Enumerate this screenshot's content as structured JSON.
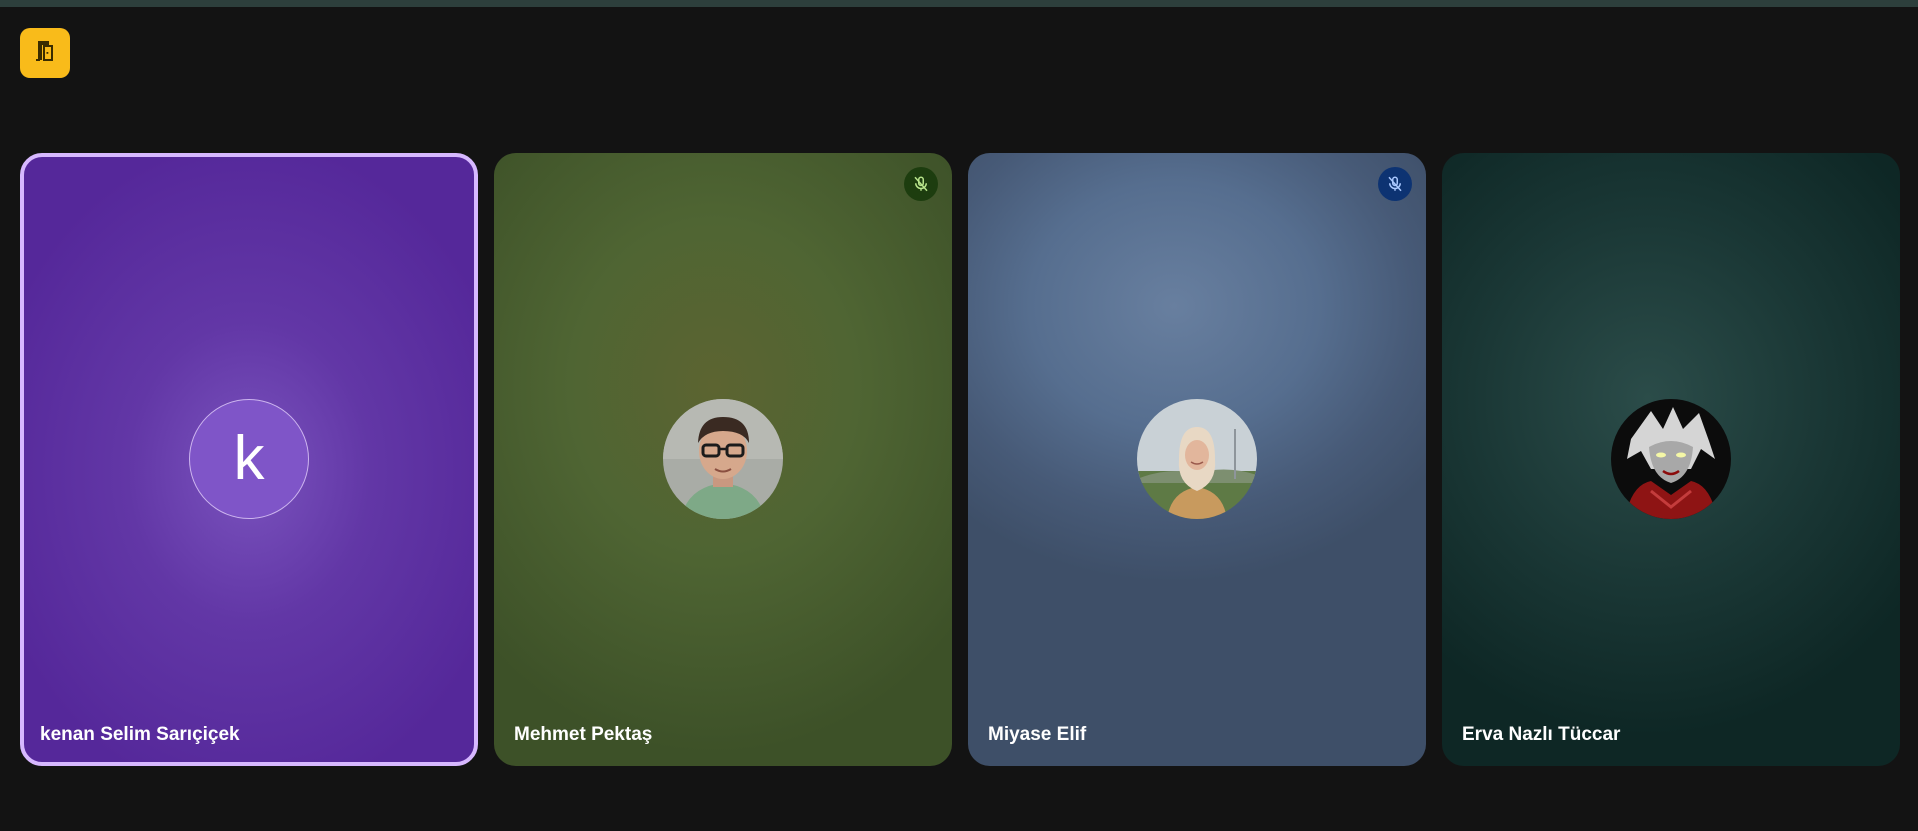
{
  "participants": [
    {
      "name": "kenan Selim Sarıçiçek",
      "initial": "k",
      "muted": false,
      "active_speaker": true,
      "avatar": "letter-avatar"
    },
    {
      "name": "Mehmet Pektaş",
      "muted": true,
      "active_speaker": false,
      "avatar": "photo-man-glasses"
    },
    {
      "name": "Miyase Elif",
      "muted": true,
      "active_speaker": false,
      "avatar": "photo-woman-headscarf"
    },
    {
      "name": "Erva Nazlı Tüccar",
      "muted": false,
      "active_speaker": false,
      "avatar": "photo-anime-character"
    }
  ],
  "icons": {
    "leave": "door-exit-icon",
    "mute": "mic-off-icon"
  },
  "colors": {
    "leave_button": "#f9bb1a",
    "active_speaker_border": "#d7b8ff",
    "background": "#131313"
  }
}
